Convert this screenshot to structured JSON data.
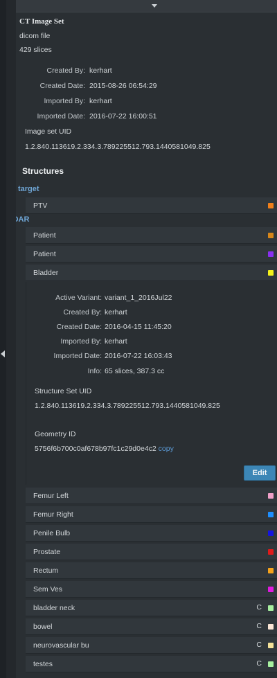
{
  "image_set": {
    "title": "CT Image Set",
    "format": "dicom file",
    "slices": "429 slices",
    "fields": [
      {
        "label": "Created By:",
        "value": "kerhart"
      },
      {
        "label": "Created Date:",
        "value": "2015-08-26 06:54:29"
      },
      {
        "label": "Imported By:",
        "value": "kerhart"
      },
      {
        "label": "Imported Date:",
        "value": "2016-07-22 16:00:51"
      }
    ],
    "uid_label": "Image set UID",
    "uid_value": "1.2.840.113619.2.334.3.789225512.793.1440581049.825"
  },
  "structures": {
    "title": "Structures",
    "groups": {
      "target": "target",
      "oar": "OAR"
    },
    "target_rows": [
      {
        "name": "PTV",
        "color": "#f07f1a"
      }
    ],
    "oar_rows_top": [
      {
        "name": "Patient",
        "color": "#d7861a"
      },
      {
        "name": "Patient",
        "color": "#8a2ff0"
      },
      {
        "name": "Bladder",
        "color": "#f5f21b"
      }
    ],
    "bladder_detail": {
      "fields": [
        {
          "label": "Active Variant:",
          "value": "variant_1_2016Jul22"
        },
        {
          "label": "Created By:",
          "value": "kerhart"
        },
        {
          "label": "Created Date:",
          "value": "2016-04-15 11:45:20"
        },
        {
          "label": "Imported By:",
          "value": "kerhart"
        },
        {
          "label": "Imported Date:",
          "value": "2016-07-22 16:03:43"
        },
        {
          "label": "Info:",
          "value": "65 slices, 387.3 cc"
        }
      ],
      "structure_set_uid_label": "Structure Set UID",
      "structure_set_uid_value": "1.2.840.113619.2.334.3.789225512.793.1440581049.825",
      "geometry_id_label": "Geometry ID",
      "geometry_id_value": "5756f6b700c0af678b97fc1c29d0e4c2",
      "copy_label": "copy",
      "edit_label": "Edit"
    },
    "oar_rows_bottom": [
      {
        "name": "Femur Left",
        "color": "#f0a0c8",
        "c": ""
      },
      {
        "name": "Femur Right",
        "color": "#1e8fff",
        "c": ""
      },
      {
        "name": "Penile Bulb",
        "color": "#1515e0",
        "c": ""
      },
      {
        "name": "Prostate",
        "color": "#e01a1a",
        "c": ""
      },
      {
        "name": "Rectum",
        "color": "#f5a21b",
        "c": ""
      },
      {
        "name": "Sem Ves",
        "color": "#e01ae0",
        "c": ""
      },
      {
        "name": "bladder neck",
        "color": "#a8f0a0",
        "c": "C"
      },
      {
        "name": "bowel",
        "color": "#fbe6d6",
        "c": "C"
      },
      {
        "name": "neurovascular bu",
        "color": "#f5e29a",
        "c": "C"
      },
      {
        "name": "testes",
        "color": "#a8f0a0",
        "c": "C"
      }
    ]
  }
}
